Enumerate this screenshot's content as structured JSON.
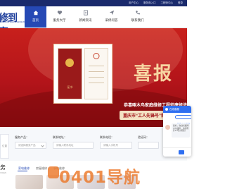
{
  "topbar": {
    "links": [
      "用户中心",
      "服务商入口",
      "工程师中心",
      "登录"
    ]
  },
  "logo": {
    "mark": "修到家",
    "tagline": "XIUDAOJIA MAINTENANCE PLATFORM"
  },
  "nav": {
    "items": [
      {
        "label": "首页",
        "icon": "home-icon",
        "active": true
      },
      {
        "label": "服务大厅",
        "icon": "heart-icon",
        "active": false
      },
      {
        "label": "新闻资讯",
        "icon": "document-icon",
        "active": false
      },
      {
        "label": "采修问答",
        "icon": "send-icon",
        "active": false
      },
      {
        "label": "联系我们",
        "icon": "phone-icon",
        "active": false
      }
    ]
  },
  "banner": {
    "cert_title": "证书",
    "headline": "喜报",
    "slogan": "恭喜啄木鸟家庭维修工程师唐修进",
    "ribbon": "重庆市“工人先锋号”荣誉称号"
  },
  "filters": {
    "fields": [
      {
        "label": "服务产品：",
        "placeholder": "请选择服务产品"
      },
      {
        "label": "联系地址：",
        "placeholder": "请输入联系地址"
      },
      {
        "label": "联系电话：",
        "placeholder": "请输入手机号"
      },
      {
        "label": "验证码：",
        "placeholder": ""
      }
    ],
    "side_placeholder": "位置"
  },
  "section": {
    "title": "务",
    "subtitle": "VICES",
    "tabs": [
      "家电维修",
      "房屋维修",
      "水电维修"
    ]
  },
  "chat": {
    "title": "在线客服",
    "button": "转至在线客服",
    "message": "您好，欢迎光临啄木鸟维修，请问有什么可以帮您？"
  },
  "watermark": {
    "text": "0401导航"
  },
  "colors": {
    "brand_blue": "#2649b5",
    "banner_red": "#c8201c",
    "watermark_orange": "#ec7828"
  }
}
